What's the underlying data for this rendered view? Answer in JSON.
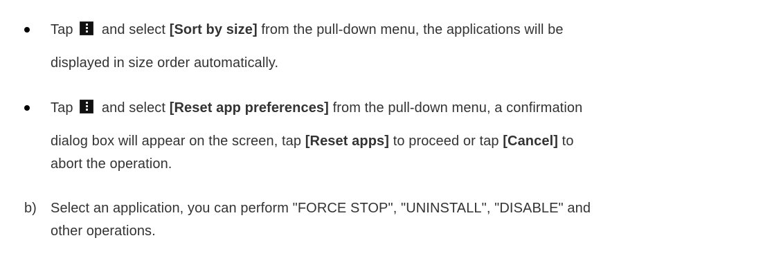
{
  "bullets": [
    {
      "tap": "Tap",
      "and_select": "and select",
      "option": "[Sort by size]",
      "rest_line1": "from the pull-down menu, the applications will be",
      "line2": "displayed in size order automatically.",
      "icon": "overflow-menu-icon"
    },
    {
      "tap": "Tap",
      "and_select": "and select",
      "option": "[Reset app preferences]",
      "rest_line1": "from the pull-down menu, a confirmation",
      "line2_a": "dialog box will appear on the screen, tap",
      "reset_apps": "[Reset apps]",
      "line2_b": "to proceed or tap",
      "cancel": "[Cancel]",
      "line2_c": "to",
      "line3": "abort the operation.",
      "icon": "overflow-menu-icon"
    }
  ],
  "item_b": {
    "marker": "b)",
    "line1": "Select an application, you can perform \"FORCE STOP\", \"UNINSTALL\", \"DISABLE\" and",
    "line2": "other operations."
  }
}
